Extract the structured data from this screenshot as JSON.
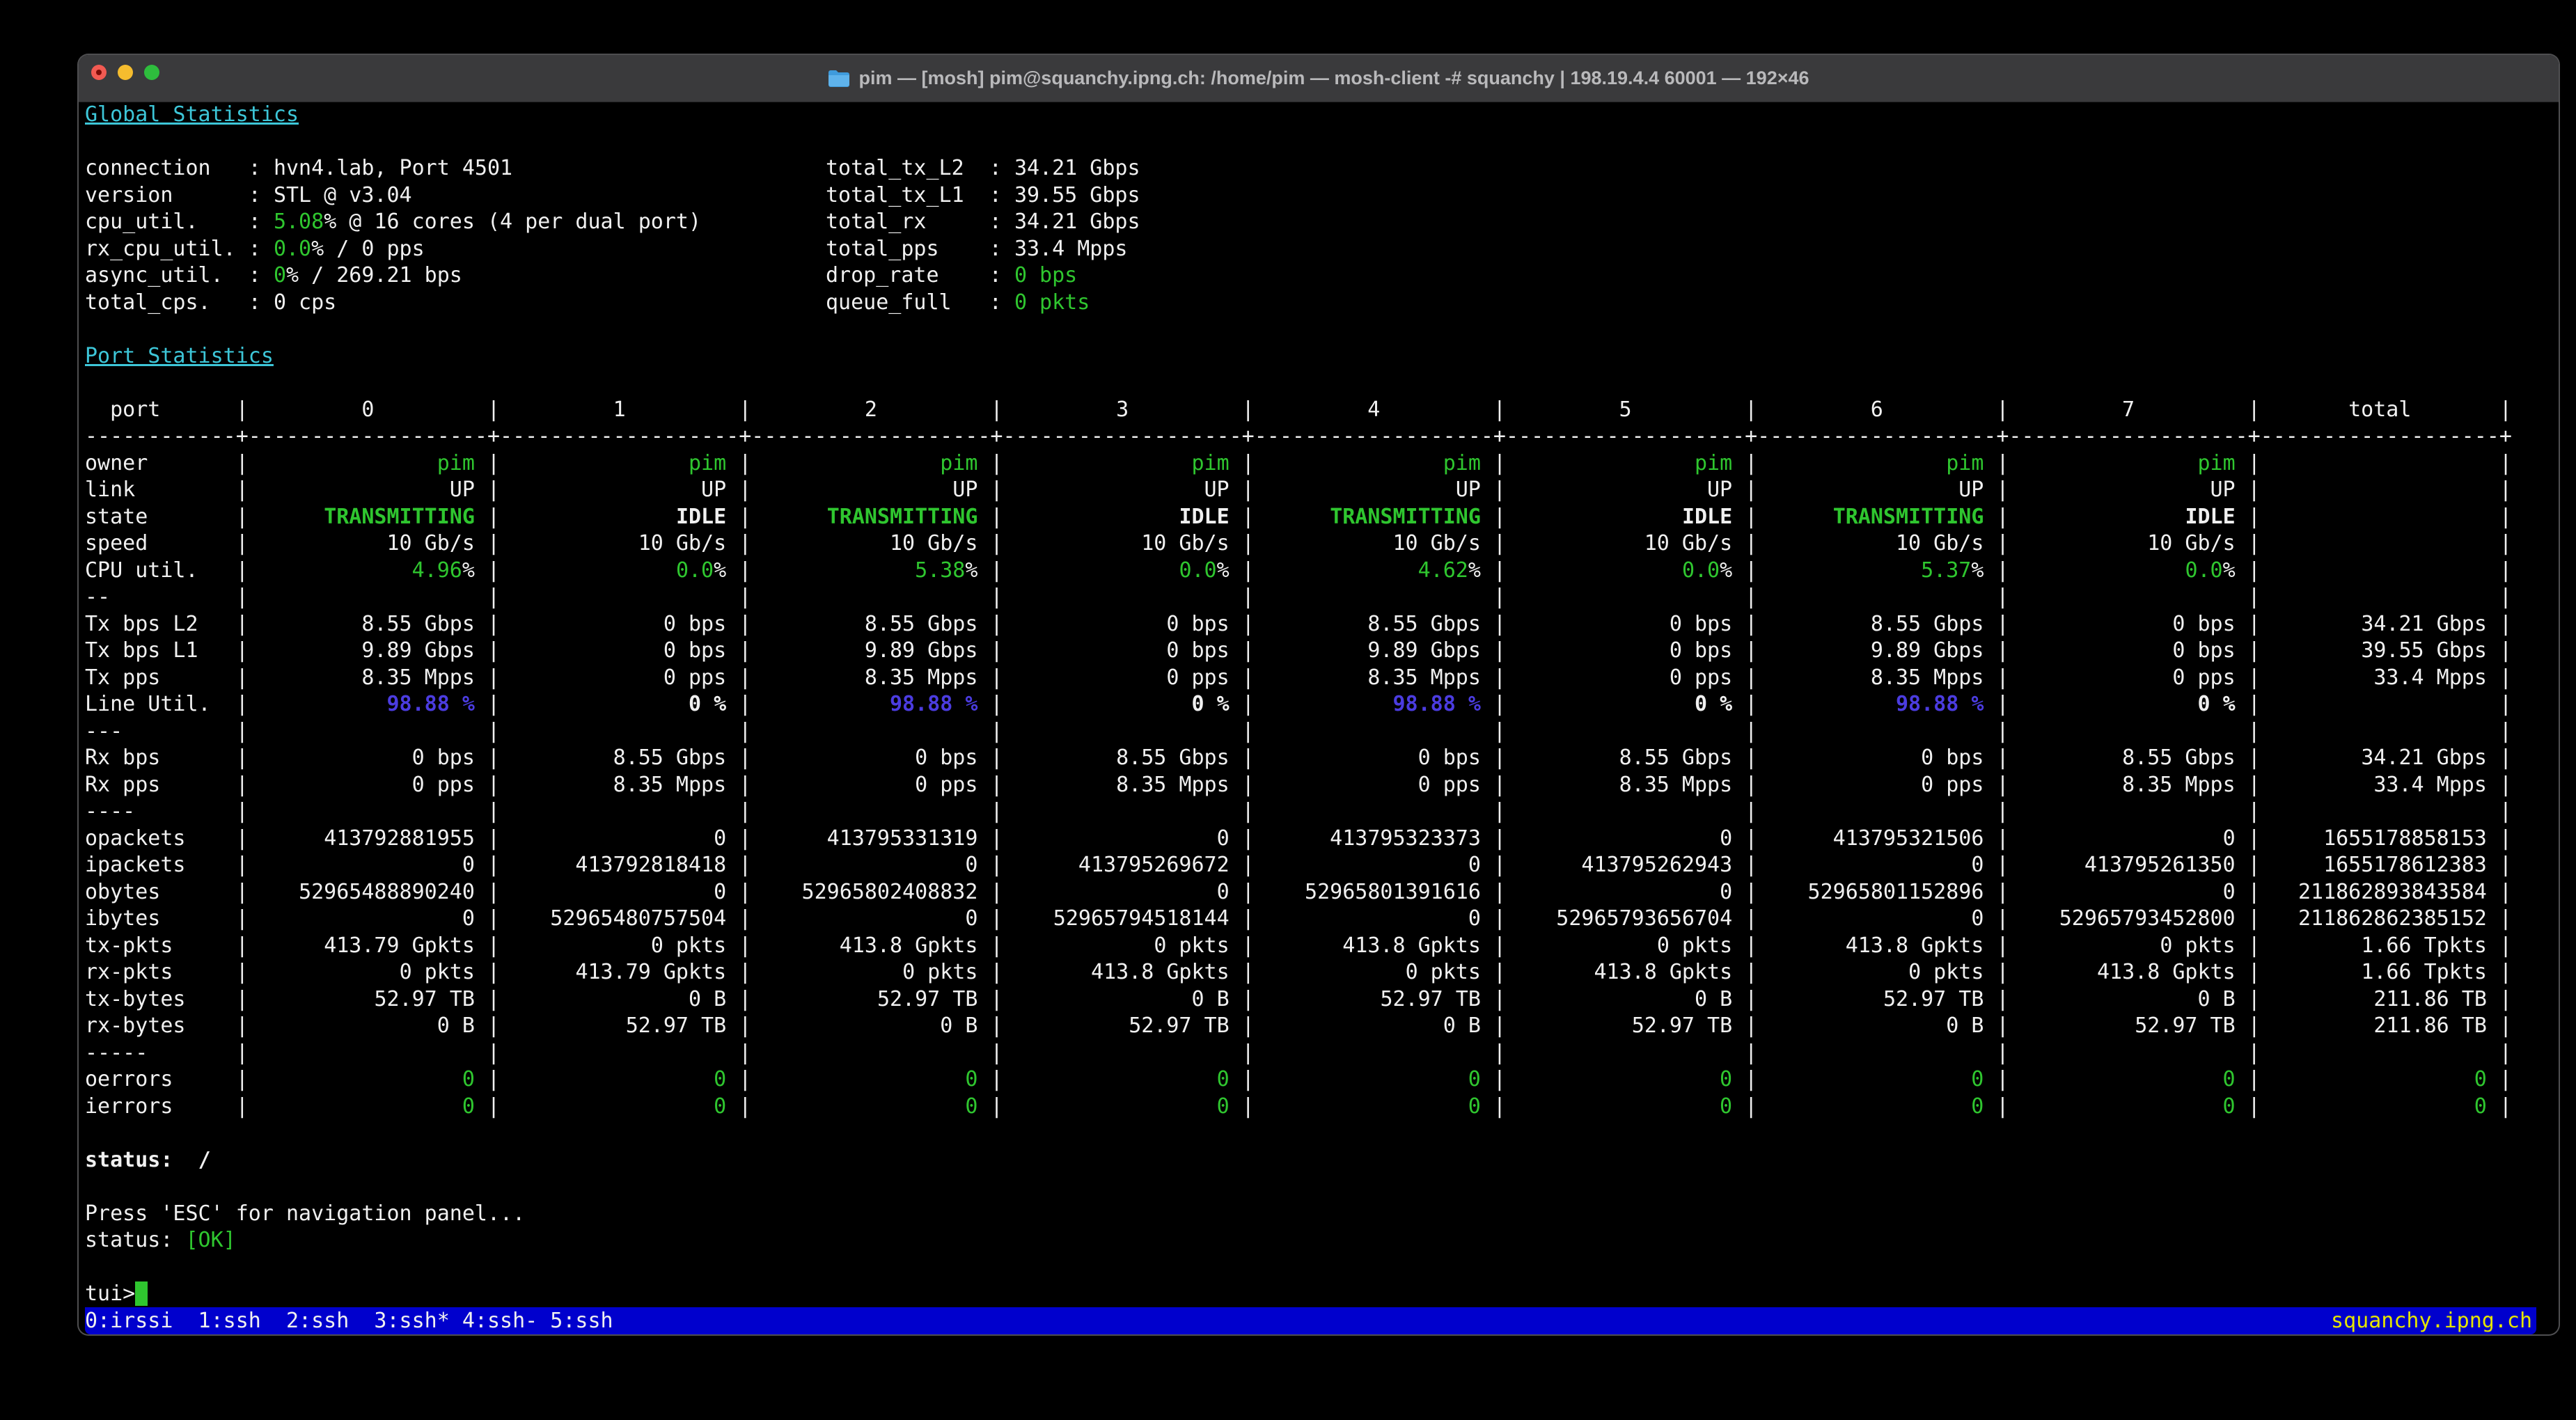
{
  "window": {
    "title": "pim — [mosh] pim@squanchy.ipng.ch: /home/pim — mosh-client -# squanchy | 198.19.4.4 60001 — 192×46",
    "traffic_lights": [
      "close",
      "minimize",
      "zoom"
    ]
  },
  "colors": {
    "green": "#2fc62f",
    "cyan": "#3dc6d8",
    "blue": "#4b3ce0",
    "white": "#f0f0f0",
    "bar_blue": "#0000cd",
    "yellow": "#e5e500"
  },
  "global": {
    "title": "Global Statistics",
    "left": [
      {
        "label": "connection",
        "parts": [
          {
            "t": "hvn4.lab, Port 4501"
          }
        ]
      },
      {
        "label": "version",
        "parts": [
          {
            "t": "STL @ v3.04"
          }
        ]
      },
      {
        "label": "cpu_util.",
        "parts": [
          {
            "t": "5.08",
            "c": "green"
          },
          {
            "t": "% @ 16 cores (4 per dual port)"
          }
        ]
      },
      {
        "label": "rx_cpu_util.",
        "parts": [
          {
            "t": "0.0",
            "c": "green"
          },
          {
            "t": "% / 0 pps"
          }
        ]
      },
      {
        "label": "async_util.",
        "parts": [
          {
            "t": "0",
            "c": "green"
          },
          {
            "t": "% / 269.21 bps"
          }
        ]
      },
      {
        "label": "total_cps.",
        "parts": [
          {
            "t": "0 cps"
          }
        ]
      }
    ],
    "right": [
      {
        "label": "total_tx_L2",
        "parts": [
          {
            "t": "34.21 Gbps"
          }
        ]
      },
      {
        "label": "total_tx_L1",
        "parts": [
          {
            "t": "39.55 Gbps"
          }
        ]
      },
      {
        "label": "total_rx",
        "parts": [
          {
            "t": "34.21 Gbps"
          }
        ]
      },
      {
        "label": "total_pps",
        "parts": [
          {
            "t": "33.4 Mpps"
          }
        ]
      },
      {
        "label": "drop_rate",
        "parts": [
          {
            "t": "0 bps",
            "c": "green"
          }
        ]
      },
      {
        "label": "queue_full",
        "parts": [
          {
            "t": "0 pkts",
            "c": "green"
          }
        ]
      }
    ]
  },
  "table": {
    "title": "Port Statistics",
    "corner": "port",
    "columns": [
      "0",
      "1",
      "2",
      "3",
      "4",
      "5",
      "6",
      "7",
      "total"
    ],
    "rows": [
      {
        "label": "owner",
        "cells": [
          [
            {
              "t": "pim",
              "c": "green"
            }
          ],
          [
            {
              "t": "pim",
              "c": "green"
            }
          ],
          [
            {
              "t": "pim",
              "c": "green"
            }
          ],
          [
            {
              "t": "pim",
              "c": "green"
            }
          ],
          [
            {
              "t": "pim",
              "c": "green"
            }
          ],
          [
            {
              "t": "pim",
              "c": "green"
            }
          ],
          [
            {
              "t": "pim",
              "c": "green"
            }
          ],
          [
            {
              "t": "pim",
              "c": "green"
            }
          ],
          ""
        ]
      },
      {
        "label": "link",
        "cells": [
          "UP",
          "UP",
          "UP",
          "UP",
          "UP",
          "UP",
          "UP",
          "UP",
          ""
        ]
      },
      {
        "label": "state",
        "cells": [
          [
            {
              "t": "TRANSMITTING",
              "c": "green",
              "b": 1
            }
          ],
          [
            {
              "t": "IDLE",
              "b": 1
            }
          ],
          [
            {
              "t": "TRANSMITTING",
              "c": "green",
              "b": 1
            }
          ],
          [
            {
              "t": "IDLE",
              "b": 1
            }
          ],
          [
            {
              "t": "TRANSMITTING",
              "c": "green",
              "b": 1
            }
          ],
          [
            {
              "t": "IDLE",
              "b": 1
            }
          ],
          [
            {
              "t": "TRANSMITTING",
              "c": "green",
              "b": 1
            }
          ],
          [
            {
              "t": "IDLE",
              "b": 1
            }
          ],
          ""
        ]
      },
      {
        "label": "speed",
        "cells": [
          "10 Gb/s",
          "10 Gb/s",
          "10 Gb/s",
          "10 Gb/s",
          "10 Gb/s",
          "10 Gb/s",
          "10 Gb/s",
          "10 Gb/s",
          ""
        ]
      },
      {
        "label": "CPU util.",
        "cells": [
          [
            {
              "t": "4.96",
              "c": "green"
            },
            {
              "t": "%"
            }
          ],
          [
            {
              "t": "0.0",
              "c": "green"
            },
            {
              "t": "%"
            }
          ],
          [
            {
              "t": "5.38",
              "c": "green"
            },
            {
              "t": "%"
            }
          ],
          [
            {
              "t": "0.0",
              "c": "green"
            },
            {
              "t": "%"
            }
          ],
          [
            {
              "t": "4.62",
              "c": "green"
            },
            {
              "t": "%"
            }
          ],
          [
            {
              "t": "0.0",
              "c": "green"
            },
            {
              "t": "%"
            }
          ],
          [
            {
              "t": "5.37",
              "c": "green"
            },
            {
              "t": "%"
            }
          ],
          [
            {
              "t": "0.0",
              "c": "green"
            },
            {
              "t": "%"
            }
          ],
          ""
        ]
      },
      {
        "label": "--",
        "sep": true
      },
      {
        "label": "Tx bps L2",
        "cells": [
          "8.55 Gbps",
          "0 bps",
          "8.55 Gbps",
          "0 bps",
          "8.55 Gbps",
          "0 bps",
          "8.55 Gbps",
          "0 bps",
          "34.21 Gbps"
        ]
      },
      {
        "label": "Tx bps L1",
        "cells": [
          "9.89 Gbps",
          "0 bps",
          "9.89 Gbps",
          "0 bps",
          "9.89 Gbps",
          "0 bps",
          "9.89 Gbps",
          "0 bps",
          "39.55 Gbps"
        ]
      },
      {
        "label": "Tx pps",
        "cells": [
          "8.35 Mpps",
          "0 pps",
          "8.35 Mpps",
          "0 pps",
          "8.35 Mpps",
          "0 pps",
          "8.35 Mpps",
          "0 pps",
          "33.4 Mpps"
        ]
      },
      {
        "label": "Line Util.",
        "cells": [
          [
            {
              "t": "98.88 %",
              "c": "blue",
              "b": 1
            }
          ],
          [
            {
              "t": "0 %",
              "b": 1
            }
          ],
          [
            {
              "t": "98.88 %",
              "c": "blue",
              "b": 1
            }
          ],
          [
            {
              "t": "0 %",
              "b": 1
            }
          ],
          [
            {
              "t": "98.88 %",
              "c": "blue",
              "b": 1
            }
          ],
          [
            {
              "t": "0 %",
              "b": 1
            }
          ],
          [
            {
              "t": "98.88 %",
              "c": "blue",
              "b": 1
            }
          ],
          [
            {
              "t": "0 %",
              "b": 1
            }
          ],
          ""
        ]
      },
      {
        "label": "---",
        "sep": true
      },
      {
        "label": "Rx bps",
        "cells": [
          "0 bps",
          "8.55 Gbps",
          "0 bps",
          "8.55 Gbps",
          "0 bps",
          "8.55 Gbps",
          "0 bps",
          "8.55 Gbps",
          "34.21 Gbps"
        ]
      },
      {
        "label": "Rx pps",
        "cells": [
          "0 pps",
          "8.35 Mpps",
          "0 pps",
          "8.35 Mpps",
          "0 pps",
          "8.35 Mpps",
          "0 pps",
          "8.35 Mpps",
          "33.4 Mpps"
        ]
      },
      {
        "label": "----",
        "sep": true
      },
      {
        "label": "opackets",
        "cells": [
          "413792881955",
          "0",
          "413795331319",
          "0",
          "413795323373",
          "0",
          "413795321506",
          "0",
          "1655178858153"
        ]
      },
      {
        "label": "ipackets",
        "cells": [
          "0",
          "413792818418",
          "0",
          "413795269672",
          "0",
          "413795262943",
          "0",
          "413795261350",
          "1655178612383"
        ]
      },
      {
        "label": "obytes",
        "cells": [
          "52965488890240",
          "0",
          "52965802408832",
          "0",
          "52965801391616",
          "0",
          "52965801152896",
          "0",
          "211862893843584"
        ]
      },
      {
        "label": "ibytes",
        "cells": [
          "0",
          "52965480757504",
          "0",
          "52965794518144",
          "0",
          "52965793656704",
          "0",
          "52965793452800",
          "211862862385152"
        ]
      },
      {
        "label": "tx-pkts",
        "cells": [
          "413.79 Gpkts",
          "0 pkts",
          "413.8 Gpkts",
          "0 pkts",
          "413.8 Gpkts",
          "0 pkts",
          "413.8 Gpkts",
          "0 pkts",
          "1.66 Tpkts"
        ]
      },
      {
        "label": "rx-pkts",
        "cells": [
          "0 pkts",
          "413.79 Gpkts",
          "0 pkts",
          "413.8 Gpkts",
          "0 pkts",
          "413.8 Gpkts",
          "0 pkts",
          "413.8 Gpkts",
          "1.66 Tpkts"
        ]
      },
      {
        "label": "tx-bytes",
        "cells": [
          "52.97 TB",
          "0 B",
          "52.97 TB",
          "0 B",
          "52.97 TB",
          "0 B",
          "52.97 TB",
          "0 B",
          "211.86 TB"
        ]
      },
      {
        "label": "rx-bytes",
        "cells": [
          "0 B",
          "52.97 TB",
          "0 B",
          "52.97 TB",
          "0 B",
          "52.97 TB",
          "0 B",
          "52.97 TB",
          "211.86 TB"
        ]
      },
      {
        "label": "-----",
        "sep": true
      },
      {
        "label": "oerrors",
        "cells": [
          [
            {
              "t": "0",
              "c": "green"
            }
          ],
          [
            {
              "t": "0",
              "c": "green"
            }
          ],
          [
            {
              "t": "0",
              "c": "green"
            }
          ],
          [
            {
              "t": "0",
              "c": "green"
            }
          ],
          [
            {
              "t": "0",
              "c": "green"
            }
          ],
          [
            {
              "t": "0",
              "c": "green"
            }
          ],
          [
            {
              "t": "0",
              "c": "green"
            }
          ],
          [
            {
              "t": "0",
              "c": "green"
            }
          ],
          [
            {
              "t": "0",
              "c": "green"
            }
          ]
        ]
      },
      {
        "label": "ierrors",
        "cells": [
          [
            {
              "t": "0",
              "c": "green"
            }
          ],
          [
            {
              "t": "0",
              "c": "green"
            }
          ],
          [
            {
              "t": "0",
              "c": "green"
            }
          ],
          [
            {
              "t": "0",
              "c": "green"
            }
          ],
          [
            {
              "t": "0",
              "c": "green"
            }
          ],
          [
            {
              "t": "0",
              "c": "green"
            }
          ],
          [
            {
              "t": "0",
              "c": "green"
            }
          ],
          [
            {
              "t": "0",
              "c": "green"
            }
          ],
          [
            {
              "t": "0",
              "c": "green"
            }
          ]
        ]
      }
    ]
  },
  "footer": {
    "status_spinner": {
      "label": "status:",
      "value": "/"
    },
    "press_esc": "Press 'ESC' for navigation panel...",
    "status_ok": {
      "label": "status:",
      "value": "[OK]"
    },
    "prompt": "tui>",
    "bar": {
      "windows": "0:irssi  1:ssh  2:ssh  3:ssh* 4:ssh- 5:ssh",
      "host": "squanchy.ipng.ch"
    }
  }
}
